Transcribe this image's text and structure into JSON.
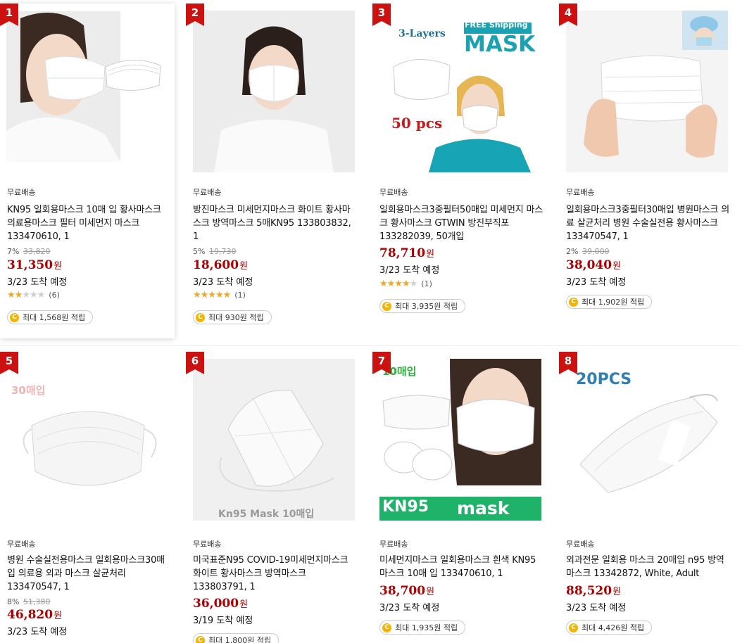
{
  "products": [
    {
      "rank": "1",
      "shipping": "무료배송",
      "title": "KN95 일회용마스크 10매 입 황사마스크 의료용마스크 필터 미세먼지 마스크 133470610, 1",
      "discount": "7%",
      "original_price": "33,820",
      "price": "31,350",
      "currency": "원",
      "delivery": "3/23 도착 예정",
      "rating": 1.5,
      "review_count": "(6)",
      "reward": "최대 1,568원 적립"
    },
    {
      "rank": "2",
      "shipping": "무료배송",
      "title": "방진마스크 미세먼지마스크 화이트 황사마스크 방역마스크 5매KN95 133803832, 1",
      "discount": "5%",
      "original_price": "19,730",
      "price": "18,600",
      "currency": "원",
      "delivery": "3/23 도착 예정",
      "rating": 5,
      "review_count": "(1)",
      "reward": "최대 930원 적립"
    },
    {
      "rank": "3",
      "shipping": "무료배송",
      "title": "일회용마스크3중필터50매입 미세먼지 마스크 황사마스크 GTWIN 방진부직포 133282039, 50개입",
      "discount": "",
      "original_price": "",
      "price": "78,710",
      "currency": "원",
      "delivery": "3/23 도착 예정",
      "rating": 4,
      "review_count": "(1)",
      "reward": "최대 3,935원 적립",
      "image_text": {
        "top": "3-Layers",
        "shipping_badge": "FREE Shipping",
        "big": "MASK",
        "count": "50 pcs"
      }
    },
    {
      "rank": "4",
      "shipping": "무료배송",
      "title": "일회용마스크3중필터30매입 병원마스크 의료 살균처리 병원 수술실전용 황사마스크 133470547, 1",
      "discount": "2%",
      "original_price": "39,000",
      "price": "38,040",
      "currency": "원",
      "delivery": "3/23 도착 예정",
      "reward": "최대 1,902원 적립"
    },
    {
      "rank": "5",
      "shipping": "무료배송",
      "title": "병원 수술실전용마스크 일회용마스크30매입 의료용 외과 마스크 살균처리133470547, 1",
      "discount": "8%",
      "original_price": "51,380",
      "price": "46,820",
      "currency": "원",
      "delivery": "3/23 도착 예정",
      "image_text": {
        "label": "30매입"
      }
    },
    {
      "rank": "6",
      "shipping": "무료배송",
      "title": "미국표준N95 COVID-19미세먼지마스크 화이트 황사마스크 방역마스크 133803791, 1",
      "price": "36,000",
      "currency": "원",
      "delivery": "3/19 도착 예정",
      "reward": "최대 1,800원 적립",
      "image_text": {
        "label": "Kn95 Mask 10매입"
      }
    },
    {
      "rank": "7",
      "shipping": "무료배송",
      "title": "미세먼지마스크 일회용마스크 흰색 KN95 마스크 10매 입 133470610, 1",
      "price": "38,700",
      "currency": "원",
      "delivery": "3/23 도착 예정",
      "reward": "최대 1,935원 적립",
      "image_text": {
        "label": "10매입",
        "left": "KN95",
        "right": "mask"
      }
    },
    {
      "rank": "8",
      "shipping": "무료배송",
      "title": "외과전문 일회용 마스크 20매입 n95 방역마스크 13342872, White, Adult",
      "price": "88,520",
      "currency": "원",
      "delivery": "3/23 도착 예정",
      "reward": "최대 4,426원 적립",
      "image_text": {
        "label": "20PCS"
      }
    }
  ],
  "colors": {
    "rank_badge": "#cc1111",
    "price": "#ae0000",
    "star": "#f5a623",
    "coin": "#f4b400"
  }
}
